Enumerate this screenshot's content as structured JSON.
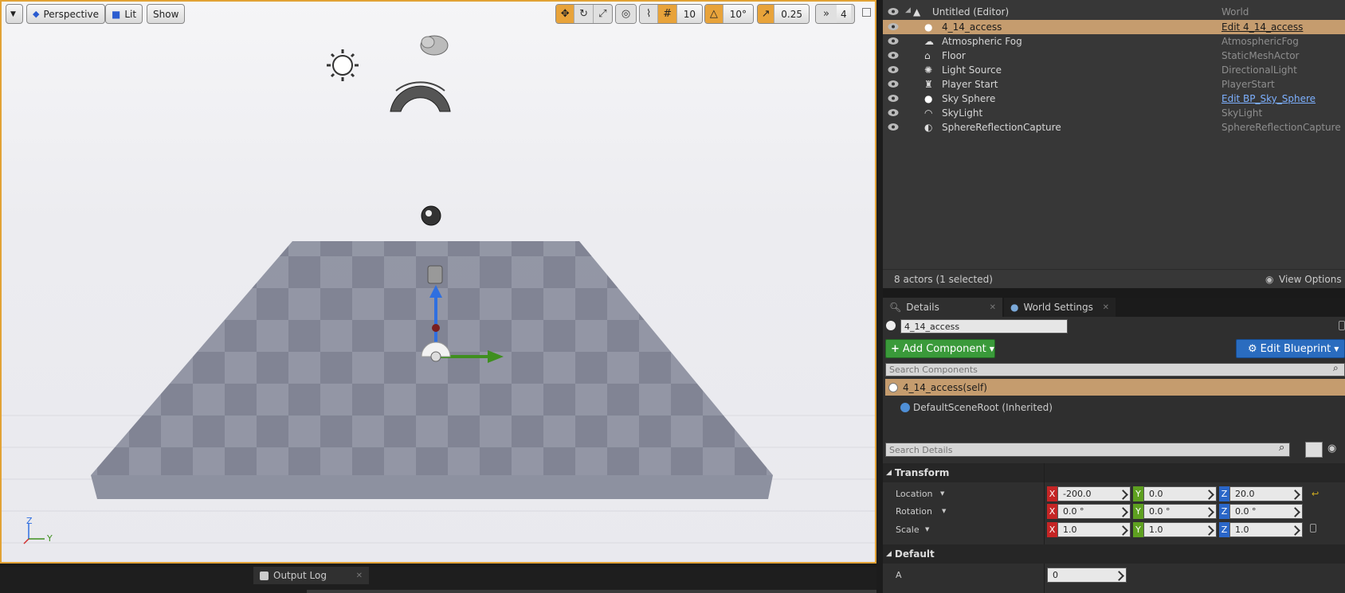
{
  "viewport": {
    "toolbar": {
      "perspective": "Perspective",
      "lit": "Lit",
      "show": "Show"
    },
    "snap": {
      "grid": "10",
      "rotation": "10°",
      "scale": "0.25",
      "speed": "4"
    },
    "axis": {
      "z": "Z",
      "y": "Y"
    }
  },
  "outliner": {
    "rows": [
      {
        "name": "Untitled (Editor)",
        "type": "World"
      },
      {
        "name": "4_14_access",
        "type": "Edit 4_14_access"
      },
      {
        "name": "Atmospheric Fog",
        "type": "AtmosphericFog"
      },
      {
        "name": "Floor",
        "type": "StaticMeshActor"
      },
      {
        "name": "Light Source",
        "type": "DirectionalLight"
      },
      {
        "name": "Player Start",
        "type": "PlayerStart"
      },
      {
        "name": "Sky Sphere",
        "type": "Edit BP_Sky_Sphere"
      },
      {
        "name": "SkyLight",
        "type": "SkyLight"
      },
      {
        "name": "SphereReflectionCapture",
        "type": "SphereReflectionCapture"
      }
    ],
    "status": "8 actors (1 selected)",
    "view_options": "View Options"
  },
  "details": {
    "tabs": {
      "details": "Details",
      "world": "World Settings"
    },
    "actor_name": "4_14_access",
    "add_component": "Add Component",
    "edit_blueprint": "Edit Blueprint",
    "search_components": "Search Components",
    "self_comp": "4_14_access(self)",
    "root_comp": "DefaultSceneRoot (Inherited)",
    "search_details": "Search Details",
    "transform": {
      "title": "Transform",
      "location": {
        "label": "Location",
        "x": "-200.0",
        "y": "0.0",
        "z": "20.0"
      },
      "rotation": {
        "label": "Rotation",
        "x": "0.0 °",
        "y": "0.0 °",
        "z": "0.0 °"
      },
      "scale": {
        "label": "Scale",
        "x": "1.0",
        "y": "1.0",
        "z": "1.0"
      }
    },
    "default": {
      "title": "Default",
      "a_label": "A",
      "a_value": "0"
    },
    "axis": {
      "x": "X",
      "y": "Y",
      "z": "Z"
    }
  },
  "bottom": {
    "output_log": "Output Log"
  }
}
